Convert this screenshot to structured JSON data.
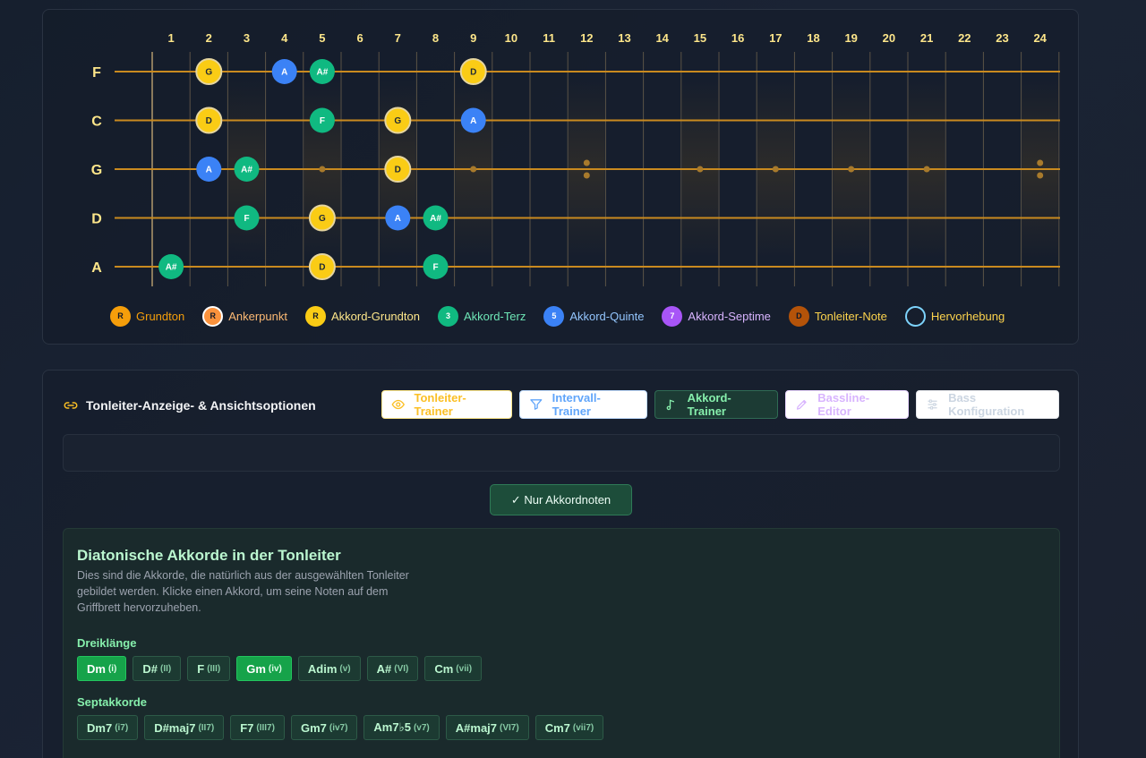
{
  "fretboard": {
    "fret_numbers": [
      "1",
      "2",
      "3",
      "4",
      "5",
      "6",
      "7",
      "8",
      "9",
      "10",
      "11",
      "12",
      "13",
      "14",
      "15",
      "16",
      "17",
      "18",
      "19",
      "20",
      "21",
      "22",
      "23",
      "24"
    ],
    "strings": [
      "F",
      "C",
      "G",
      "D",
      "A"
    ],
    "notes": [
      {
        "string": 0,
        "fret": 2,
        "label": "G",
        "role": "chord-root"
      },
      {
        "string": 0,
        "fret": 4,
        "label": "A",
        "role": "fifth"
      },
      {
        "string": 0,
        "fret": 5,
        "label": "A#",
        "role": "third"
      },
      {
        "string": 0,
        "fret": 9,
        "label": "D",
        "role": "chord-root"
      },
      {
        "string": 1,
        "fret": 2,
        "label": "D",
        "role": "chord-root"
      },
      {
        "string": 1,
        "fret": 5,
        "label": "F",
        "role": "third"
      },
      {
        "string": 1,
        "fret": 7,
        "label": "G",
        "role": "chord-root"
      },
      {
        "string": 1,
        "fret": 9,
        "label": "A",
        "role": "fifth"
      },
      {
        "string": 2,
        "fret": 2,
        "label": "A",
        "role": "fifth"
      },
      {
        "string": 2,
        "fret": 3,
        "label": "A#",
        "role": "third"
      },
      {
        "string": 2,
        "fret": 7,
        "label": "D",
        "role": "chord-root"
      },
      {
        "string": 3,
        "fret": 3,
        "label": "F",
        "role": "third"
      },
      {
        "string": 3,
        "fret": 5,
        "label": "G",
        "role": "chord-root"
      },
      {
        "string": 3,
        "fret": 7,
        "label": "A",
        "role": "fifth"
      },
      {
        "string": 3,
        "fret": 8,
        "label": "A#",
        "role": "third"
      },
      {
        "string": 4,
        "fret": 1,
        "label": "A#",
        "role": "third"
      },
      {
        "string": 4,
        "fret": 5,
        "label": "D",
        "role": "chord-root"
      },
      {
        "string": 4,
        "fret": 8,
        "label": "F",
        "role": "third"
      }
    ],
    "colors": {
      "chord-root": "#facc15",
      "third": "#10b981",
      "fifth": "#3b82f6",
      "string": "#c98a1f",
      "fret": "#5b5346"
    }
  },
  "legend": [
    {
      "symbol": "R",
      "label": "Grundton",
      "color": "#f59e0b",
      "ring": "#f59e0b",
      "text_color": "#f59e0b"
    },
    {
      "symbol": "R",
      "label": "Ankerpunkt",
      "color": "#fb923c",
      "ring": "#ffffff",
      "text_color": "#fdba74"
    },
    {
      "symbol": "R",
      "label": "Akkord-Grundton",
      "color": "#facc15",
      "ring": "#facc15",
      "text_color": "#fde68a"
    },
    {
      "symbol": "3",
      "label": "Akkord-Terz",
      "color": "#10b981",
      "ring": "#10b981",
      "text_color": "#6ee7b7"
    },
    {
      "symbol": "5",
      "label": "Akkord-Quinte",
      "color": "#3b82f6",
      "ring": "#3b82f6",
      "text_color": "#93c5fd"
    },
    {
      "symbol": "7",
      "label": "Akkord-Septime",
      "color": "#a855f7",
      "ring": "#a855f7",
      "text_color": "#d8b4fe"
    },
    {
      "symbol": "D",
      "label": "Tonleiter-Note",
      "color": "#b45309",
      "ring": "#b45309",
      "text_color": "#fcd34d"
    },
    {
      "symbol": "",
      "label": "Hervorhebung",
      "color": "transparent",
      "ring": "#7dd3fc",
      "text_color": "#fcd34d"
    }
  ],
  "options": {
    "title": "Tonleiter-Anzeige- & Ansichtsoptionen",
    "tabs": {
      "scale": "Tonleiter-Trainer",
      "interval": "Intervall-Trainer",
      "chord": "Akkord-Trainer",
      "bass": "Bassline-Editor",
      "config": "Bass Konfiguration"
    },
    "only_chord_notes": "✓ Nur Akkordnoten"
  },
  "diatonic": {
    "title": "Diatonische Akkorde in der Tonleiter",
    "description": "Dies sind die Akkorde, die natürlich aus der ausgewählten Tonleiter gebildet werden. Klicke einen Akkord, um seine Noten auf dem Griffbrett hervorzuheben.",
    "triads_label": "Dreiklänge",
    "triads": [
      {
        "name": "Dm",
        "roman": "(i)",
        "active": true
      },
      {
        "name": "D#",
        "roman": "(II)",
        "active": false
      },
      {
        "name": "F",
        "roman": "(III)",
        "active": false
      },
      {
        "name": "Gm",
        "roman": "(iv)",
        "active": true
      },
      {
        "name": "Adim",
        "roman": "(v)",
        "active": false
      },
      {
        "name": "A#",
        "roman": "(VI)",
        "active": false
      },
      {
        "name": "Cm",
        "roman": "(vii)",
        "active": false
      }
    ],
    "sevenths_label": "Septakkorde",
    "sevenths": [
      {
        "name": "Dm7",
        "roman": "(i7)",
        "active": false
      },
      {
        "name": "D#maj7",
        "roman": "(II7)",
        "active": false
      },
      {
        "name": "F7",
        "roman": "(III7)",
        "active": false
      },
      {
        "name": "Gm7",
        "roman": "(iv7)",
        "active": false
      },
      {
        "name": "Am7♭5",
        "roman": "(v7)",
        "active": false
      },
      {
        "name": "A#maj7",
        "roman": "(VI7)",
        "active": false
      },
      {
        "name": "Cm7",
        "roman": "(vii7)",
        "active": false
      }
    ]
  }
}
